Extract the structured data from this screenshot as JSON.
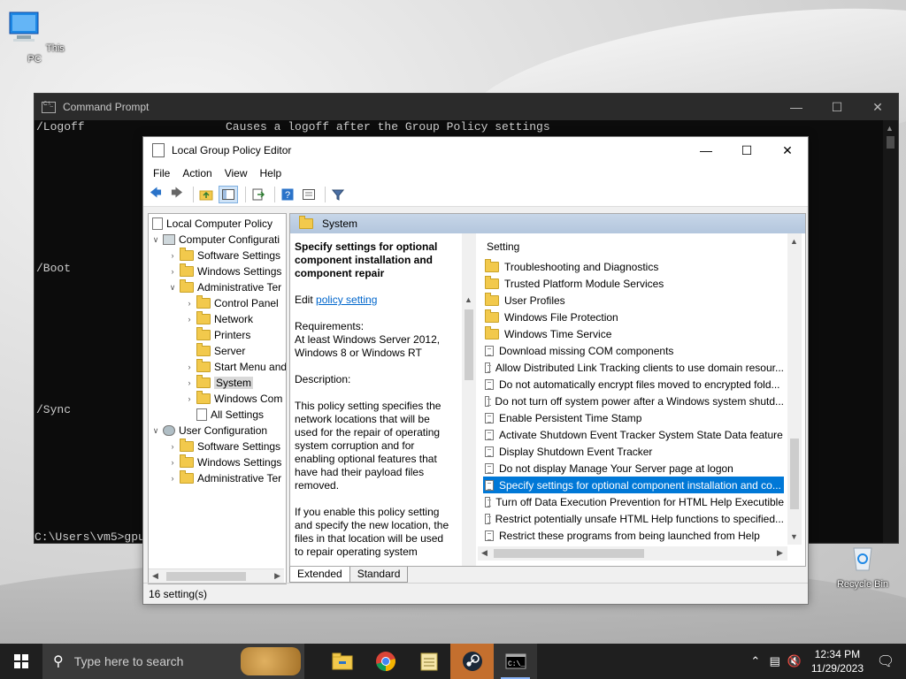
{
  "desktop": {
    "icons": [
      {
        "label": "This PC"
      },
      {
        "label": "Recycle Bin"
      }
    ]
  },
  "cmd": {
    "title": "Command Prompt",
    "lines": {
      "logoff_switch": "/Logoff",
      "logoff_desc": "Causes a logoff after the Group Policy settings",
      "boot": "/Boot",
      "sync": "/Sync",
      "prompt": "C:\\Users\\vm5>gpu"
    }
  },
  "gp": {
    "title": "Local Group Policy Editor",
    "menu": [
      "File",
      "Action",
      "View",
      "Help"
    ],
    "tree": [
      {
        "label": "Local Computer Policy"
      },
      {
        "label": "Computer Configurati"
      },
      {
        "label": "Software Settings"
      },
      {
        "label": "Windows Settings"
      },
      {
        "label": "Administrative Ter"
      },
      {
        "label": "Control Panel"
      },
      {
        "label": "Network"
      },
      {
        "label": "Printers"
      },
      {
        "label": "Server"
      },
      {
        "label": "Start Menu and"
      },
      {
        "label": "System"
      },
      {
        "label": "Windows Com"
      },
      {
        "label": "All Settings"
      },
      {
        "label": "User Configuration"
      },
      {
        "label": "Software Settings"
      },
      {
        "label": "Windows Settings"
      },
      {
        "label": "Administrative Ter"
      }
    ],
    "header_folder": "System",
    "desc": {
      "title": "Specify settings for optional component installation and component repair",
      "edit_prefix": "Edit ",
      "edit_link": "policy setting",
      "req_label": "Requirements:",
      "req_value": "At least Windows Server 2012, Windows 8 or Windows RT",
      "desc_label": "Description:",
      "para1": "This policy setting specifies the network locations that will be used for the repair of operating system corruption and for enabling optional features that have had their payload files removed.",
      "para2": "If you enable this policy setting and specify the new location, the files in that location will be used to repair operating system"
    },
    "list_header": "Setting",
    "items": [
      {
        "label": "Troubleshooting and Diagnostics",
        "kind": "folder"
      },
      {
        "label": "Trusted Platform Module Services",
        "kind": "folder"
      },
      {
        "label": "User Profiles",
        "kind": "folder"
      },
      {
        "label": "Windows File Protection",
        "kind": "folder"
      },
      {
        "label": "Windows Time Service",
        "kind": "folder"
      },
      {
        "label": "Download missing COM components",
        "kind": "policy"
      },
      {
        "label": "Allow Distributed Link Tracking clients to use domain resour...",
        "kind": "policy"
      },
      {
        "label": "Do not automatically encrypt files moved to encrypted fold...",
        "kind": "policy"
      },
      {
        "label": "Do not turn off system power after a Windows system shutd...",
        "kind": "policy"
      },
      {
        "label": "Enable Persistent Time Stamp",
        "kind": "policy"
      },
      {
        "label": "Activate Shutdown Event Tracker System State Data feature",
        "kind": "policy"
      },
      {
        "label": "Display Shutdown Event Tracker",
        "kind": "policy"
      },
      {
        "label": "Do not display Manage Your Server page at logon",
        "kind": "policy"
      },
      {
        "label": "Specify settings for optional component installation and co...",
        "kind": "policy"
      },
      {
        "label": "Turn off Data Execution Prevention for HTML Help Executible",
        "kind": "policy"
      },
      {
        "label": "Restrict potentially unsafe HTML Help functions to specified...",
        "kind": "policy"
      },
      {
        "label": "Restrict these programs from being launched from Help",
        "kind": "policy"
      }
    ],
    "tabs": [
      "Extended",
      "Standard"
    ],
    "status": "16 setting(s)"
  },
  "taskbar": {
    "search_placeholder": "Type here to search",
    "time": "12:34 PM",
    "date": "11/29/2023"
  }
}
